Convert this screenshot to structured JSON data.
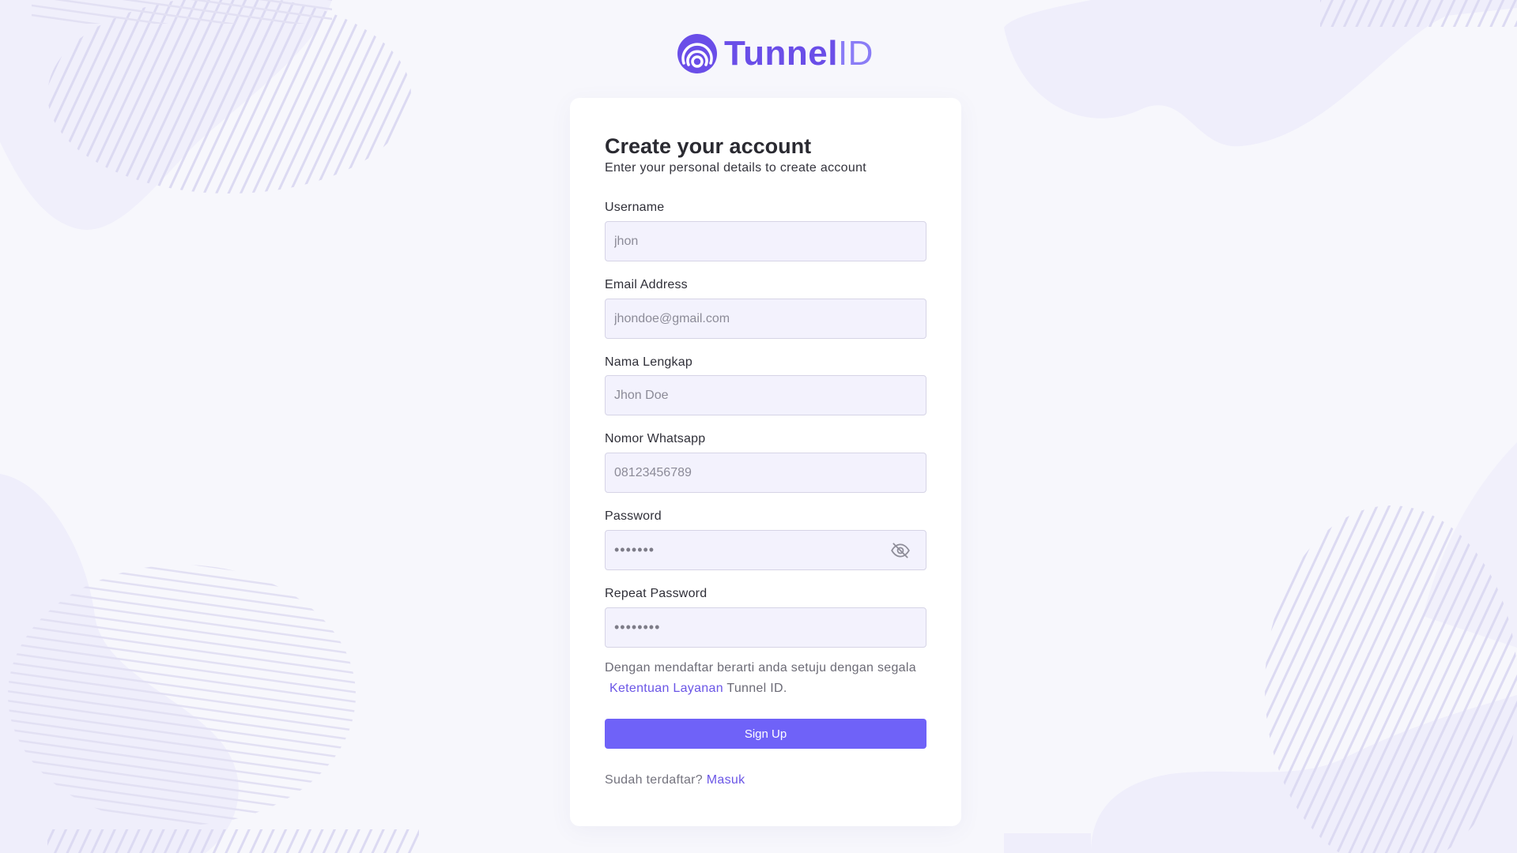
{
  "brand": {
    "name_part1": "Tunnel",
    "name_part2": "ID",
    "accent_color": "#6f62f8",
    "logo_icon": "wifi-arch-logo-icon"
  },
  "form": {
    "title": "Create your account",
    "subtitle": "Enter your personal details to create account",
    "fields": {
      "username": {
        "label": "Username",
        "placeholder": "jhon"
      },
      "email": {
        "label": "Email Address",
        "placeholder": "jhondoe@gmail.com"
      },
      "full_name": {
        "label": "Nama Lengkap",
        "placeholder": "Jhon Doe"
      },
      "whatsapp": {
        "label": "Nomor Whatsapp",
        "placeholder": "08123456789"
      },
      "password": {
        "label": "Password",
        "value": "•••••••",
        "icon": "eye-off-icon"
      },
      "repeat_password": {
        "label": "Repeat Password",
        "value": "••••••••"
      }
    },
    "terms": {
      "prefix": "Dengan mendaftar berarti anda setuju dengan segala",
      "link_text": "Ketentuan Layanan",
      "suffix": "Tunnel ID."
    },
    "submit_label": "Sign Up",
    "login": {
      "prompt": "Sudah terdaftar?",
      "link_text": "Masuk"
    }
  }
}
